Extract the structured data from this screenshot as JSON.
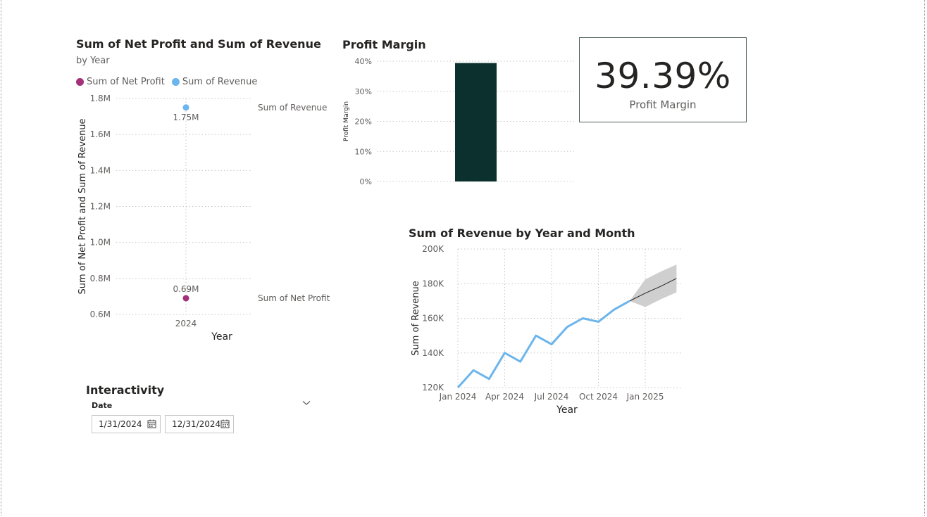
{
  "scatter": {
    "title": "Sum of Net Profit and Sum of Revenue",
    "subtitle": "by Year",
    "legend": [
      {
        "name": "Sum of Net Profit",
        "color": "#a3317a"
      },
      {
        "name": "Sum of Revenue",
        "color": "#6cb5ec"
      }
    ]
  },
  "margin_bar": {
    "title": "Profit Margin"
  },
  "card": {
    "value": "39.39%",
    "label": "Profit Margin"
  },
  "line": {
    "title": "Sum of Revenue by Year and Month"
  },
  "slicer": {
    "title": "Interactivity",
    "field": "Date",
    "start": "1/31/2024",
    "end": "12/31/2024",
    "icon": "chevron-down-icon"
  },
  "chart_data": [
    {
      "type": "scatter",
      "title": "Sum of Net Profit and Sum of Revenue",
      "subtitle": "by Year",
      "xlabel": "Year",
      "ylabel": "Sum of Net Profit and Sum of Revenue",
      "categories": [
        "2024"
      ],
      "series": [
        {
          "name": "Sum of Revenue",
          "values": [
            1750000
          ],
          "data_labels": [
            "1.75M"
          ],
          "color": "#6cb5ec"
        },
        {
          "name": "Sum of Net Profit",
          "values": [
            690000
          ],
          "data_labels": [
            "0.69M"
          ],
          "color": "#a3317a"
        }
      ],
      "yticks": [
        "1.8M",
        "1.6M",
        "1.4M",
        "1.2M",
        "1.0M",
        "0.8M",
        "0.6M"
      ],
      "ytick_values": [
        1800000,
        1600000,
        1400000,
        1200000,
        1000000,
        800000,
        600000
      ],
      "ylim": [
        600000,
        1800000
      ],
      "grid": true,
      "legend": "top-left"
    },
    {
      "type": "bar",
      "title": "Profit Margin",
      "ylabel": "Profit Margin",
      "categories": [
        ""
      ],
      "values": [
        39.39
      ],
      "color": "#0c302e",
      "yticks": [
        "40%",
        "30%",
        "20%",
        "10%",
        "0%"
      ],
      "ytick_values": [
        40,
        30,
        20,
        10,
        0
      ],
      "ylim": [
        0,
        40
      ],
      "grid": true
    },
    {
      "type": "line",
      "title": "Sum of Revenue by Year and Month",
      "xlabel": "Year",
      "ylabel": "Sum of Revenue",
      "x": [
        "2024-01",
        "2024-02",
        "2024-03",
        "2024-04",
        "2024-05",
        "2024-06",
        "2024-07",
        "2024-08",
        "2024-09",
        "2024-10",
        "2024-11",
        "2024-12"
      ],
      "series": [
        {
          "name": "Sum of Revenue",
          "values": [
            120000,
            130000,
            125000,
            140000,
            135000,
            150000,
            145000,
            155000,
            160000,
            158000,
            165000,
            170000
          ],
          "color": "#6cb5ec"
        }
      ],
      "forecast": {
        "x": [
          "2024-12",
          "2025-01",
          "2025-02",
          "2025-03"
        ],
        "values": [
          170000,
          174500,
          178500,
          183000
        ],
        "upper": [
          170000,
          182500,
          187000,
          191000
        ],
        "lower": [
          170000,
          166500,
          171000,
          175000
        ],
        "color": "#222222",
        "band_color": "#cfcfcf"
      },
      "xticks": [
        "Jan 2024",
        "Apr 2024",
        "Jul 2024",
        "Oct 2024",
        "Jan 2025"
      ],
      "xtick_dates": [
        "2024-01",
        "2024-04",
        "2024-07",
        "2024-10",
        "2025-01"
      ],
      "yticks": [
        "200K",
        "180K",
        "160K",
        "140K",
        "120K"
      ],
      "ytick_values": [
        200000,
        180000,
        160000,
        140000,
        120000
      ],
      "ylim": [
        120000,
        200000
      ],
      "grid": true
    }
  ]
}
